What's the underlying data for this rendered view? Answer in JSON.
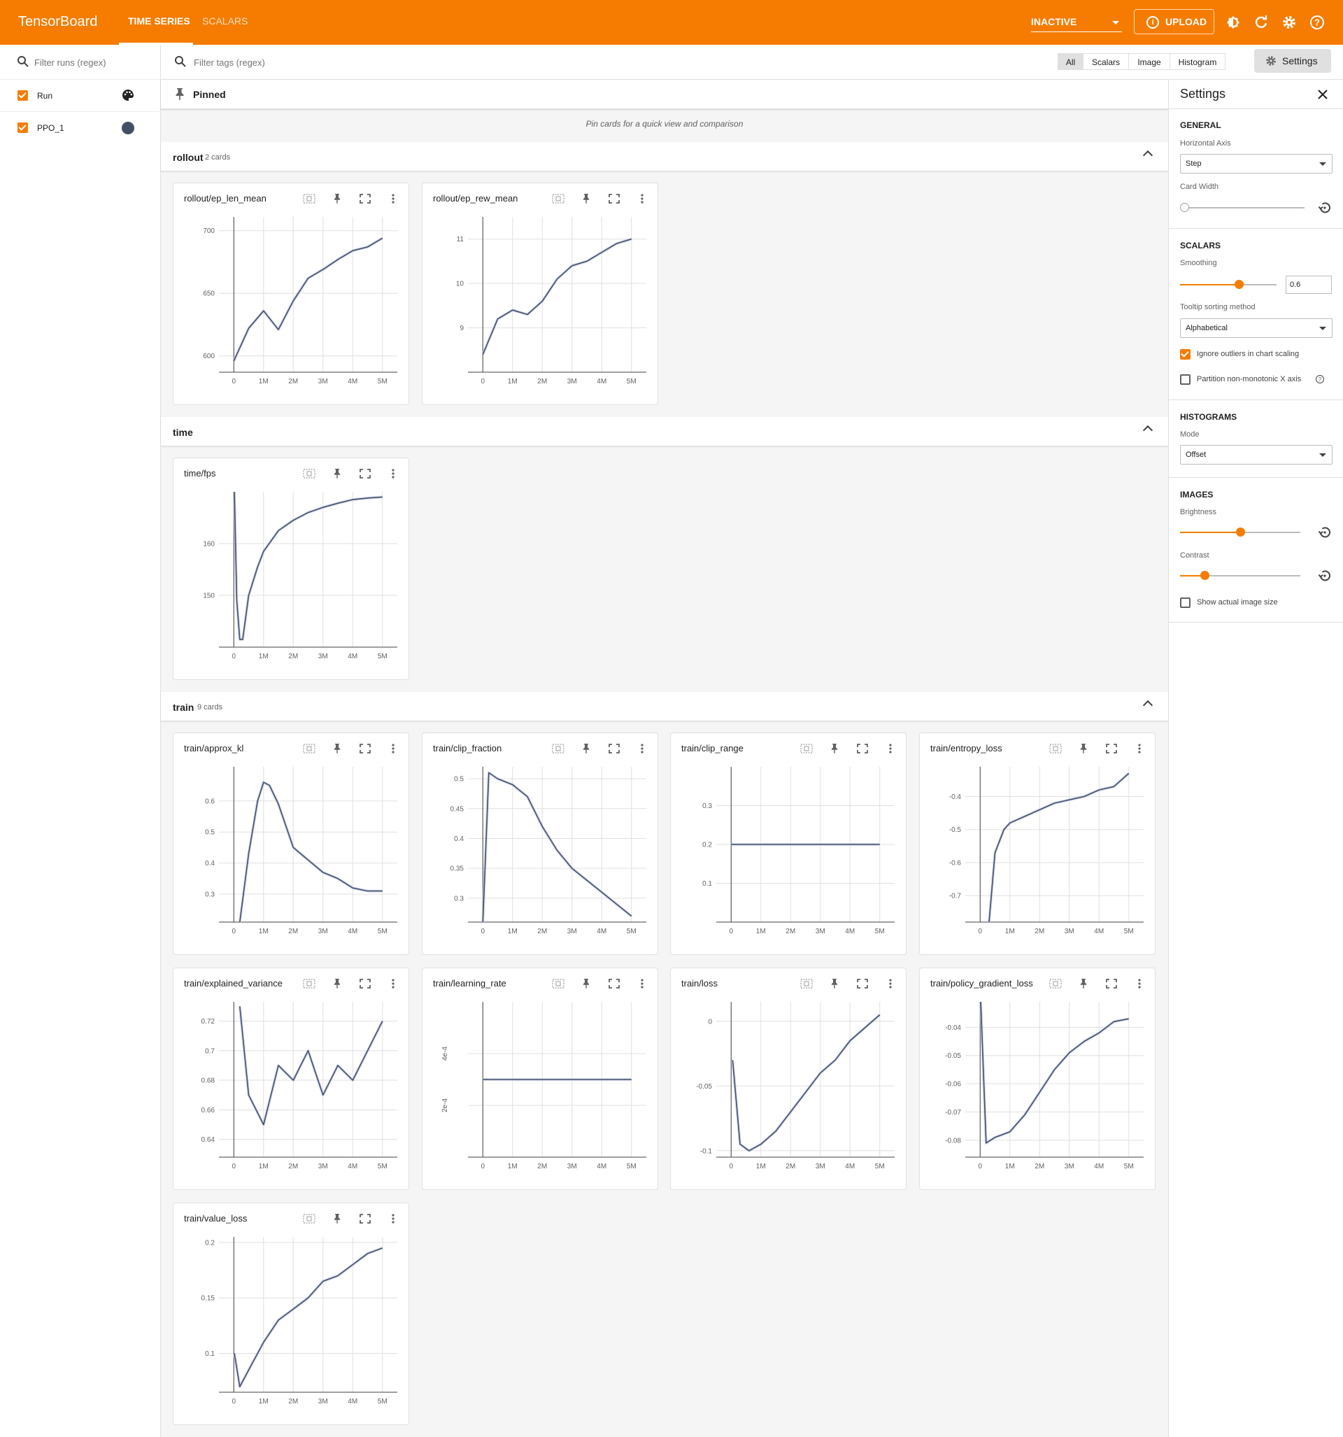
{
  "app": {
    "brand": "TensorBoard",
    "tabs": [
      {
        "label": "TIME SERIES"
      },
      {
        "label": "SCALARS"
      }
    ],
    "status_select": "INACTIVE",
    "upload_label": "UPLOAD",
    "accent_color": "#f57c00"
  },
  "runs": {
    "filter_placeholder": "Filter runs (regex)",
    "items": [
      {
        "label": "Run",
        "checked": true,
        "icon": "palette-icon"
      },
      {
        "label": "PPO_1",
        "checked": true,
        "color": "#425066"
      }
    ]
  },
  "toolbar": {
    "filter_placeholder": "Filter tags (regex)",
    "types": [
      "All",
      "Scalars",
      "Image",
      "Histogram"
    ],
    "selected_type": "All",
    "settings_label": "Settings"
  },
  "pinned": {
    "label": "Pinned",
    "message": "Pin cards for a quick view and comparison"
  },
  "sections": [
    {
      "title": "rollout",
      "count": "2 cards"
    },
    {
      "title": "time",
      "count": ""
    },
    {
      "title": "train",
      "count": "9 cards"
    }
  ],
  "chart_data": [
    {
      "type": "line",
      "title": "rollout/ep_len_mean",
      "x_ticks": [
        "0",
        "1M",
        "2M",
        "3M",
        "4M",
        "5M"
      ],
      "y_ticks": [
        "600",
        "650",
        "700"
      ],
      "ylim": [
        587,
        711
      ],
      "x": [
        0,
        0.5,
        1,
        1.5,
        2,
        2.5,
        3,
        3.5,
        4,
        4.5,
        5
      ],
      "series": [
        {
          "values": [
            596,
            622,
            636,
            621,
            644,
            662,
            669,
            677,
            684,
            687,
            694
          ]
        }
      ]
    },
    {
      "type": "line",
      "title": "rollout/ep_rew_mean",
      "x_ticks": [
        "0",
        "1M",
        "2M",
        "3M",
        "4M",
        "5M"
      ],
      "y_ticks": [
        "9",
        "10",
        "11"
      ],
      "ylim": [
        8.0,
        11.5
      ],
      "x": [
        0,
        0.5,
        1,
        1.5,
        2,
        2.5,
        3,
        3.5,
        4,
        4.5,
        5
      ],
      "series": [
        {
          "values": [
            8.4,
            9.2,
            9.4,
            9.3,
            9.6,
            10.1,
            10.4,
            10.5,
            10.7,
            10.9,
            11.0
          ]
        }
      ]
    },
    {
      "type": "line",
      "title": "time/fps",
      "x_ticks": [
        "0",
        "1M",
        "2M",
        "3M",
        "4M",
        "5M"
      ],
      "y_ticks": [
        "150",
        "160"
      ],
      "ylim": [
        140,
        170
      ],
      "x": [
        0.02,
        0.1,
        0.2,
        0.3,
        0.5,
        0.8,
        1,
        1.5,
        2,
        2.5,
        3,
        3.5,
        4,
        4.5,
        5
      ],
      "series": [
        {
          "values": [
            170,
            149,
            141.5,
            141.5,
            150,
            155.5,
            158.5,
            162.5,
            164.5,
            166,
            167,
            167.8,
            168.5,
            168.8,
            169
          ]
        }
      ]
    },
    {
      "type": "line",
      "title": "train/approx_kl",
      "x_ticks": [
        "0",
        "1M",
        "2M",
        "3M",
        "4M",
        "5M"
      ],
      "y_ticks": [
        "0.3",
        "0.4",
        "0.5",
        "0.6"
      ],
      "ylim": [
        0.21,
        0.71
      ],
      "x": [
        0.2,
        0.5,
        0.8,
        1,
        1.2,
        1.5,
        2,
        2.5,
        3,
        3.5,
        4,
        4.5,
        5
      ],
      "series": [
        {
          "values": [
            0.21,
            0.43,
            0.6,
            0.66,
            0.65,
            0.59,
            0.45,
            0.41,
            0.37,
            0.35,
            0.32,
            0.31,
            0.31
          ]
        }
      ]
    },
    {
      "type": "line",
      "title": "train/clip_fraction",
      "x_ticks": [
        "0",
        "1M",
        "2M",
        "3M",
        "4M",
        "5M"
      ],
      "y_ticks": [
        "0.3",
        "0.35",
        "0.4",
        "0.45",
        "0.5"
      ],
      "ylim": [
        0.26,
        0.52
      ],
      "x": [
        0,
        0.2,
        0.5,
        1,
        1.5,
        2,
        2.5,
        3,
        3.5,
        4,
        4.5,
        5
      ],
      "series": [
        {
          "values": [
            0.26,
            0.51,
            0.5,
            0.49,
            0.47,
            0.42,
            0.38,
            0.35,
            0.33,
            0.31,
            0.29,
            0.27
          ]
        }
      ]
    },
    {
      "type": "line",
      "title": "train/clip_range",
      "x_ticks": [
        "0",
        "1M",
        "2M",
        "3M",
        "4M",
        "5M"
      ],
      "y_ticks": [
        "0.1",
        "0.2",
        "0.3"
      ],
      "ylim": [
        0.0,
        0.4
      ],
      "x": [
        0,
        5
      ],
      "series": [
        {
          "values": [
            0.2,
            0.2
          ]
        }
      ]
    },
    {
      "type": "line",
      "title": "train/entropy_loss",
      "x_ticks": [
        "0",
        "1M",
        "2M",
        "3M",
        "4M",
        "5M"
      ],
      "y_ticks": [
        "-0.7",
        "-0.6",
        "-0.5",
        "-0.4"
      ],
      "ylim": [
        -0.78,
        -0.31
      ],
      "x": [
        0.3,
        0.5,
        0.8,
        1,
        1.5,
        2,
        2.5,
        3,
        3.5,
        4,
        4.5,
        5
      ],
      "series": [
        {
          "values": [
            -0.78,
            -0.57,
            -0.5,
            -0.48,
            -0.46,
            -0.44,
            -0.42,
            -0.41,
            -0.4,
            -0.38,
            -0.37,
            -0.33
          ]
        }
      ]
    },
    {
      "type": "line",
      "title": "train/explained_variance",
      "x_ticks": [
        "0",
        "1M",
        "2M",
        "3M",
        "4M",
        "5M"
      ],
      "y_ticks": [
        "0.64",
        "0.66",
        "0.68",
        "0.7",
        "0.72"
      ],
      "ylim": [
        0.628,
        0.733
      ],
      "x": [
        0.2,
        0.5,
        1,
        1.5,
        2,
        2.5,
        3,
        3.5,
        4,
        4.5,
        5
      ],
      "series": [
        {
          "values": [
            0.73,
            0.67,
            0.65,
            0.69,
            0.68,
            0.7,
            0.67,
            0.69,
            0.68,
            0.7,
            0.72
          ]
        }
      ]
    },
    {
      "type": "line",
      "title": "train/learning_rate",
      "x_ticks": [
        "0",
        "1M",
        "2M",
        "3M",
        "4M",
        "5M"
      ],
      "y_ticks": [
        "2e-4",
        "4e-4"
      ],
      "ylim": [
        0,
        0.0006
      ],
      "x": [
        0,
        5
      ],
      "series": [
        {
          "values": [
            0.0003,
            0.0003
          ]
        }
      ]
    },
    {
      "type": "line",
      "title": "train/loss",
      "x_ticks": [
        "0",
        "1M",
        "2M",
        "3M",
        "4M",
        "5M"
      ],
      "y_ticks": [
        "-0.1",
        "-0.05",
        "0"
      ],
      "ylim": [
        -0.105,
        0.015
      ],
      "x": [
        0.05,
        0.3,
        0.6,
        1,
        1.5,
        2,
        2.5,
        3,
        3.5,
        4,
        4.5,
        5
      ],
      "series": [
        {
          "values": [
            -0.03,
            -0.095,
            -0.1,
            -0.095,
            -0.085,
            -0.07,
            -0.055,
            -0.04,
            -0.03,
            -0.015,
            -0.005,
            0.005
          ]
        }
      ]
    },
    {
      "type": "line",
      "title": "train/policy_gradient_loss",
      "x_ticks": [
        "0",
        "1M",
        "2M",
        "3M",
        "4M",
        "5M"
      ],
      "y_ticks": [
        "-0.08",
        "-0.07",
        "-0.06",
        "-0.05",
        "-0.04"
      ],
      "ylim": [
        -0.086,
        -0.031
      ],
      "x": [
        0.02,
        0.2,
        0.5,
        1,
        1.5,
        2,
        2.5,
        3,
        3.5,
        4,
        4.5,
        5
      ],
      "series": [
        {
          "values": [
            -0.031,
            -0.081,
            -0.079,
            -0.077,
            -0.071,
            -0.063,
            -0.055,
            -0.049,
            -0.045,
            -0.042,
            -0.038,
            -0.037
          ]
        }
      ]
    },
    {
      "type": "line",
      "title": "train/value_loss",
      "x_ticks": [
        "0",
        "1M",
        "2M",
        "3M",
        "4M",
        "5M"
      ],
      "y_ticks": [
        "0.1",
        "0.15",
        "0.2"
      ],
      "ylim": [
        0.065,
        0.205
      ],
      "x": [
        0.02,
        0.2,
        0.5,
        1,
        1.5,
        2,
        2.5,
        3,
        3.5,
        4,
        4.5,
        5
      ],
      "series": [
        {
          "values": [
            0.1,
            0.07,
            0.085,
            0.11,
            0.13,
            0.14,
            0.15,
            0.165,
            0.17,
            0.18,
            0.19,
            0.195
          ]
        }
      ]
    }
  ],
  "settings": {
    "title": "Settings",
    "general": {
      "head": "GENERAL",
      "horizontal_axis_label": "Horizontal Axis",
      "horizontal_axis_value": "Step",
      "card_width_label": "Card Width",
      "card_width_level": 0
    },
    "scalars": {
      "head": "SCALARS",
      "smoothing_label": "Smoothing",
      "smoothing_value": "0.6",
      "tooltip_label": "Tooltip sorting method",
      "tooltip_value": "Alphabetical",
      "ignore_outliers": "Ignore outliers in chart scaling",
      "ignore_outliers_checked": true,
      "partition": "Partition non-monotonic X axis",
      "partition_checked": false
    },
    "histograms": {
      "head": "HISTOGRAMS",
      "mode_label": "Mode",
      "mode_value": "Offset"
    },
    "images": {
      "head": "IMAGES",
      "brightness_label": "Brightness",
      "brightness_level": 0.5,
      "contrast_label": "Contrast",
      "contrast_level": 0.2,
      "actual_size": "Show actual image size",
      "actual_size_checked": false
    }
  }
}
